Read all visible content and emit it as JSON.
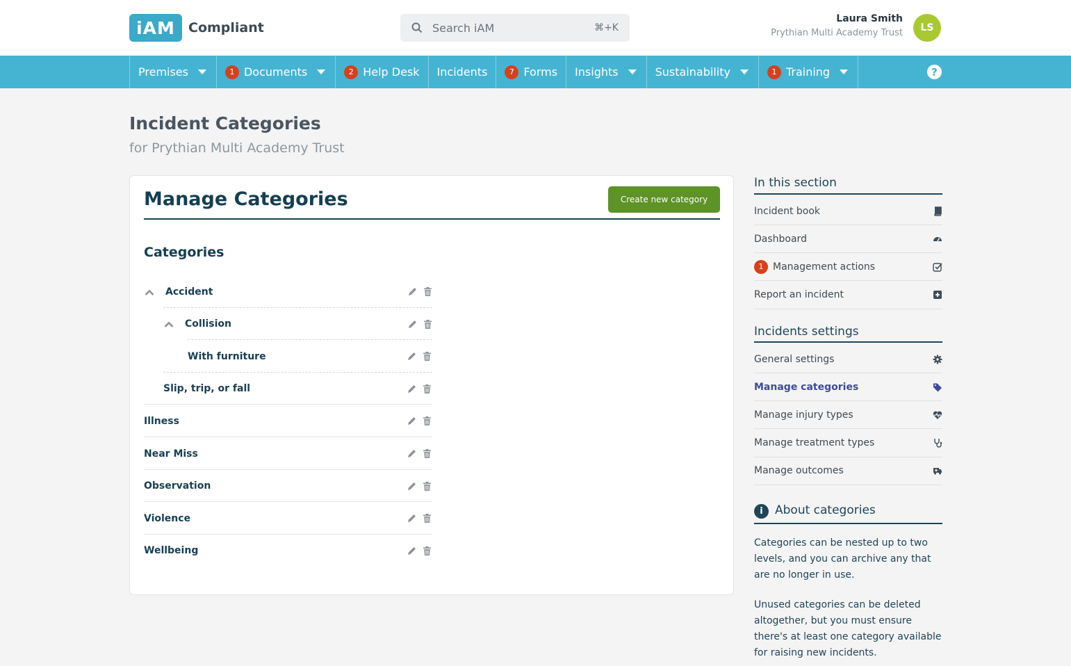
{
  "header": {
    "logo_mark": "iAM",
    "logo_text": "Compliant",
    "search_placeholder": "Search iAM",
    "search_shortcut": "⌘+K",
    "user_name": "Laura Smith",
    "user_org": "Prythian Multi Academy Trust",
    "avatar_initials": "LS"
  },
  "nav": {
    "items": [
      {
        "label": "Premises",
        "badge": null,
        "dropdown": true
      },
      {
        "label": "Documents",
        "badge": "1",
        "dropdown": true
      },
      {
        "label": "Help Desk",
        "badge": "2",
        "dropdown": false
      },
      {
        "label": "Incidents",
        "badge": null,
        "dropdown": false
      },
      {
        "label": "Forms",
        "badge": "7",
        "dropdown": false
      },
      {
        "label": "Insights",
        "badge": null,
        "dropdown": true
      },
      {
        "label": "Sustainability",
        "badge": null,
        "dropdown": true
      },
      {
        "label": "Training",
        "badge": "1",
        "dropdown": true
      }
    ],
    "help": "?"
  },
  "page": {
    "title": "Incident Categories",
    "subtitle": "for Prythian Multi Academy Trust"
  },
  "card": {
    "title": "Manage Categories",
    "create_button": "Create new category",
    "categories_heading": "Categories",
    "categories": [
      {
        "label": "Accident",
        "level": 0,
        "expanded": true
      },
      {
        "label": "Collision",
        "level": 1,
        "expanded": true
      },
      {
        "label": "With furniture",
        "level": 2,
        "expanded": null
      },
      {
        "label": "Slip, trip, or fall",
        "level": 1,
        "expanded": null
      },
      {
        "label": "Illness",
        "level": 0,
        "expanded": null
      },
      {
        "label": "Near Miss",
        "level": 0,
        "expanded": null
      },
      {
        "label": "Observation",
        "level": 0,
        "expanded": null
      },
      {
        "label": "Violence",
        "level": 0,
        "expanded": null
      },
      {
        "label": "Wellbeing",
        "level": 0,
        "expanded": null
      }
    ]
  },
  "sidebar": {
    "section_heading": "In this section",
    "section_items": [
      {
        "label": "Incident book",
        "icon": "book-icon",
        "badge": null
      },
      {
        "label": "Dashboard",
        "icon": "dashboard-icon",
        "badge": null
      },
      {
        "label": "Management actions",
        "icon": "check-square-icon",
        "badge": "1"
      },
      {
        "label": "Report an incident",
        "icon": "plus-square-icon",
        "badge": null
      }
    ],
    "settings_heading": "Incidents settings",
    "settings_items": [
      {
        "label": "General settings",
        "icon": "gear-icon",
        "active": false
      },
      {
        "label": "Manage categories",
        "icon": "tag-icon",
        "active": true
      },
      {
        "label": "Manage injury types",
        "icon": "heart-pulse-icon",
        "active": false
      },
      {
        "label": "Manage treatment types",
        "icon": "stethoscope-icon",
        "active": false
      },
      {
        "label": "Manage outcomes",
        "icon": "ambulance-icon",
        "active": false
      }
    ],
    "about_heading": "About categories",
    "about_p1": "Categories can be nested up to two levels, and you can archive any that are no longer in use.",
    "about_p2": "Unused categories can be deleted altogether, but you must ensure there's at least one category available for raising new incidents."
  },
  "colors": {
    "brand": "#45b4d3",
    "primary_button": "#5d9327",
    "badge": "#d6401d",
    "heading": "#153f52",
    "active_link": "#3f4aa0",
    "avatar": "#a8c932"
  }
}
